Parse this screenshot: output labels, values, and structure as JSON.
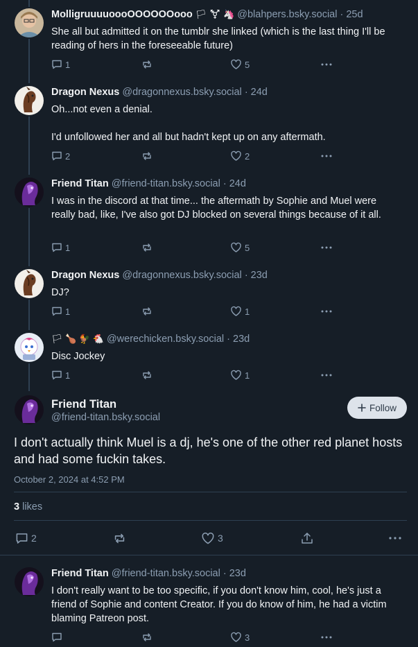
{
  "replies": [
    {
      "name": "MolligruuuuoooOOOOOOooo",
      "name_emoji": "🏳 ⚧ 🦄",
      "handle": "@blahpers.bsky.social",
      "age": "25d",
      "text": "She all but admitted it on the tumblr she linked (which is the last thing I'll be reading of hers in the foreseeable future)",
      "replies_count": "1",
      "likes_count": "5",
      "avatar": "woman-with-glasses-avatar"
    },
    {
      "name": "Dragon Nexus",
      "handle": "@dragonnexus.bsky.social",
      "age": "24d",
      "text": "Oh...not even a denial.\n\nI'd unfollowed her and all but hadn't kept up on any aftermath.",
      "replies_count": "2",
      "likes_count": "2",
      "avatar": "brown-dragon-avatar"
    },
    {
      "name": "Friend Titan",
      "handle": "@friend-titan.bsky.social",
      "age": "24d",
      "text": "I was in the discord at that time... the aftermath by Sophie and Muel were really bad, like, I've also got DJ blocked on several things because of it all.",
      "replies_count": "1",
      "likes_count": "5",
      "avatar": "purple-character-avatar"
    },
    {
      "name": "Dragon Nexus",
      "handle": "@dragonnexus.bsky.social",
      "age": "23d",
      "text": "DJ?",
      "replies_count": "1",
      "likes_count": "1",
      "avatar": "brown-dragon-avatar"
    },
    {
      "name": "",
      "name_emoji": "🏳 🍗 🐓 🐔",
      "handle": "@werechicken.bsky.social",
      "age": "23d",
      "text": "Disc Jockey",
      "replies_count": "1",
      "likes_count": "1",
      "avatar": "chicken-character-avatar"
    }
  ],
  "main_post": {
    "name": "Friend Titan",
    "handle": "@friend-titan.bsky.social",
    "follow_label": "Follow",
    "text": "I don't actually think Muel is a dj, he's one of the other red planet hosts and had some fuckin takes.",
    "date": "October 2, 2024 at 4:52 PM",
    "likes_number": "3",
    "likes_word": "likes",
    "replies_count": "2",
    "like_count": "3"
  },
  "last_reply": {
    "name": "Friend Titan",
    "handle": "@friend-titan.bsky.social",
    "age": "23d",
    "text": "I don't really want to be too specific, if you don't know him, cool, he's just a friend of Sophie and content Creator. If you do know of him, he had a victim blaming Patreon post.",
    "likes_count": "3"
  },
  "colors": {
    "background": "#161e27",
    "text": "#f1f3f5",
    "muted": "#8c9eb2",
    "thread_line": "#2e4052",
    "follow_button_bg": "#dde3ea"
  }
}
